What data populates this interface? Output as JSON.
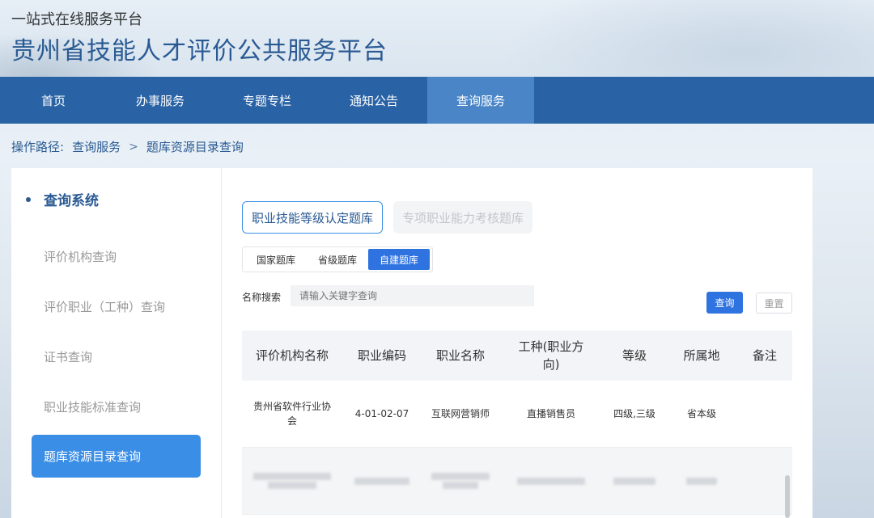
{
  "header": {
    "subtitle": "一站式在线服务平台",
    "title": "贵州省技能人才评价公共服务平台"
  },
  "nav": {
    "items": [
      {
        "label": "首页"
      },
      {
        "label": "办事服务"
      },
      {
        "label": "专题专栏"
      },
      {
        "label": "通知公告"
      },
      {
        "label": "查询服务",
        "active": true
      }
    ]
  },
  "breadcrumb": {
    "prefix": "操作路径:",
    "level1": "查询服务",
    "separator": ">",
    "level2": "题库资源目录查询"
  },
  "sidebar": {
    "heading": "查询系统",
    "items": [
      {
        "label": "评价机构查询"
      },
      {
        "label": "评价职业（工种）查询"
      },
      {
        "label": "证书查询"
      },
      {
        "label": "职业技能标准查询"
      },
      {
        "label": "题库资源目录查询",
        "active": true
      }
    ]
  },
  "content": {
    "tabs": [
      {
        "label": "职业技能等级认定题库",
        "active": true
      },
      {
        "label": "专项职业能力考核题库",
        "active": false
      }
    ],
    "segments": [
      {
        "label": "国家题库"
      },
      {
        "label": "省级题库"
      },
      {
        "label": "自建题库",
        "active": true
      }
    ],
    "search": {
      "label": "名称搜索",
      "placeholder": "请输入关键字查询",
      "query_button": "查询",
      "reset_button": "重置"
    },
    "table": {
      "headers": [
        "评价机构名称",
        "职业编码",
        "职业名称",
        "工种(职业方向)",
        "等级",
        "所属地",
        "备注"
      ],
      "rows": [
        [
          "贵州省软件行业协会",
          "4-01-02-07",
          "互联网营销师",
          "直播销售员",
          "四级,三级",
          "省本级",
          ""
        ]
      ]
    }
  }
}
